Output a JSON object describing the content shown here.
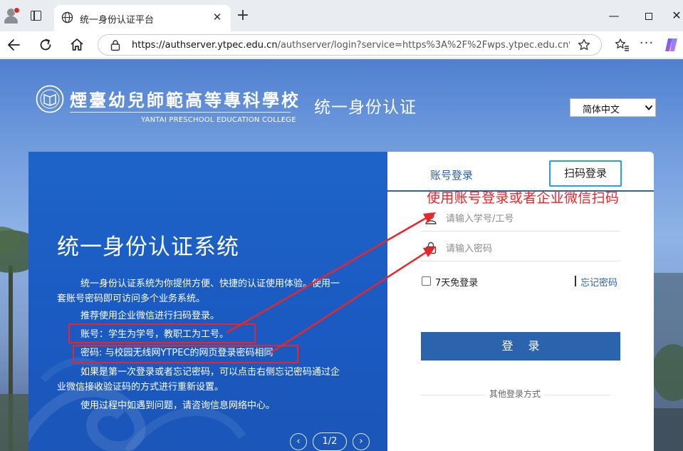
{
  "browser": {
    "tab_title": "统一身份认证平台",
    "url_host": "https://authserver.ytpec.edu.cn",
    "url_rest": "/authserver/login?service=https%3A%2F%2Fwps.ytpec.edu.cn%2F...",
    "icons": [
      "profile-icon",
      "tab-actions-icon",
      "globe-icon",
      "close-icon",
      "new-tab-icon",
      "minimize-icon",
      "maximize-icon",
      "window-close-icon",
      "back-icon",
      "reload-icon",
      "home-icon",
      "lock-icon",
      "star-icon",
      "favorites-icon",
      "more-icon",
      "copilot-icon"
    ]
  },
  "header": {
    "college_name": "煙臺幼兒師範高等專科學校",
    "college_name_en": "YANTAI PRESCHOOL EDUCATION COLLEGE",
    "title": "统一身份认证",
    "language_selected": "简体中文"
  },
  "info": {
    "system_title": "统一身份认证系统",
    "para1_line1": "统一身份认证系统为你提供方便、快捷的认证使用体验。使用一",
    "para1_line2": "套账号密码即可访问多个业务系统。",
    "para2": "推荐使用企业微信进行扫码登录。",
    "para3": "账号：学生为学号，教职工为工号。",
    "para4": "密码: 与校园无线网YTPEC的网页登录密码相同",
    "para5_line1": "如果是第一次登录或者忘记密码，可以点击右侧忘记密码通过企",
    "para5_line2": "业微信接收验证码的方式进行重新设置。",
    "para6": "使用过程中如遇到问题，请咨询信息网络中心。",
    "pager": {
      "prev": "‹",
      "page": "1/2",
      "next": "›"
    }
  },
  "login": {
    "tab_account": "账号登录",
    "tab_qr": "扫码登录",
    "annotation": "使用账号登录或者企业微信扫码",
    "username_placeholder": "请输入学号/工号",
    "password_placeholder": "请输入密码",
    "remember_label": "7天免登录",
    "forgot_label": "忘记密码",
    "login_button": "登 录",
    "other_methods": "其他登录方式"
  },
  "colors": {
    "primary_blue": "#2b63ad",
    "panel_blue": "#1e64c8",
    "annotation_red": "#e8262a",
    "qr_tab_border": "#2a9dea"
  }
}
